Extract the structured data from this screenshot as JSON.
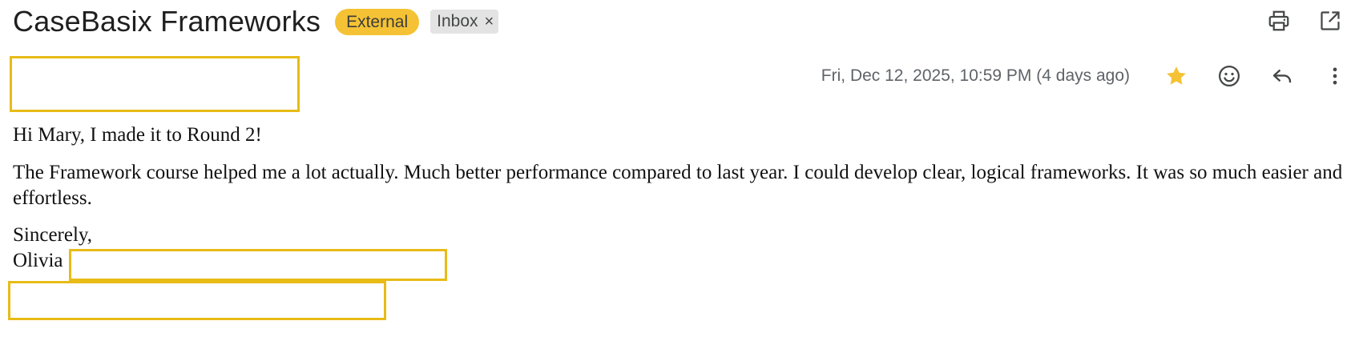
{
  "email": {
    "subject": "CaseBasix Frameworks",
    "labels": {
      "external": "External",
      "inbox": "Inbox",
      "inbox_remove": "×"
    },
    "top_actions": {
      "print_icon": "print-icon",
      "open_new_window_icon": "open-in-new-window-icon"
    },
    "date": "Fri, Dec 12, 2025, 10:59 PM (4 days ago)",
    "actions": {
      "star_icon": "star-icon",
      "emoji_icon": "emoji-reaction-icon",
      "reply_icon": "reply-icon",
      "more_icon": "more-vert-icon"
    },
    "body": {
      "greeting": "Hi Mary, I made it to Round 2!",
      "paragraph": "The Framework course helped me a lot actually. Much better performance compared to last year. I could develop clear, logical frameworks. It was so much easier and effortless.",
      "closing": "Sincerely,",
      "signature_name": "Olivia"
    }
  },
  "colors": {
    "external_label": "#f4c234",
    "inbox_label": "#e3e3e3",
    "star": "#f4c234",
    "redaction_border": "#e8bb17",
    "icon_gray": "#444746"
  }
}
